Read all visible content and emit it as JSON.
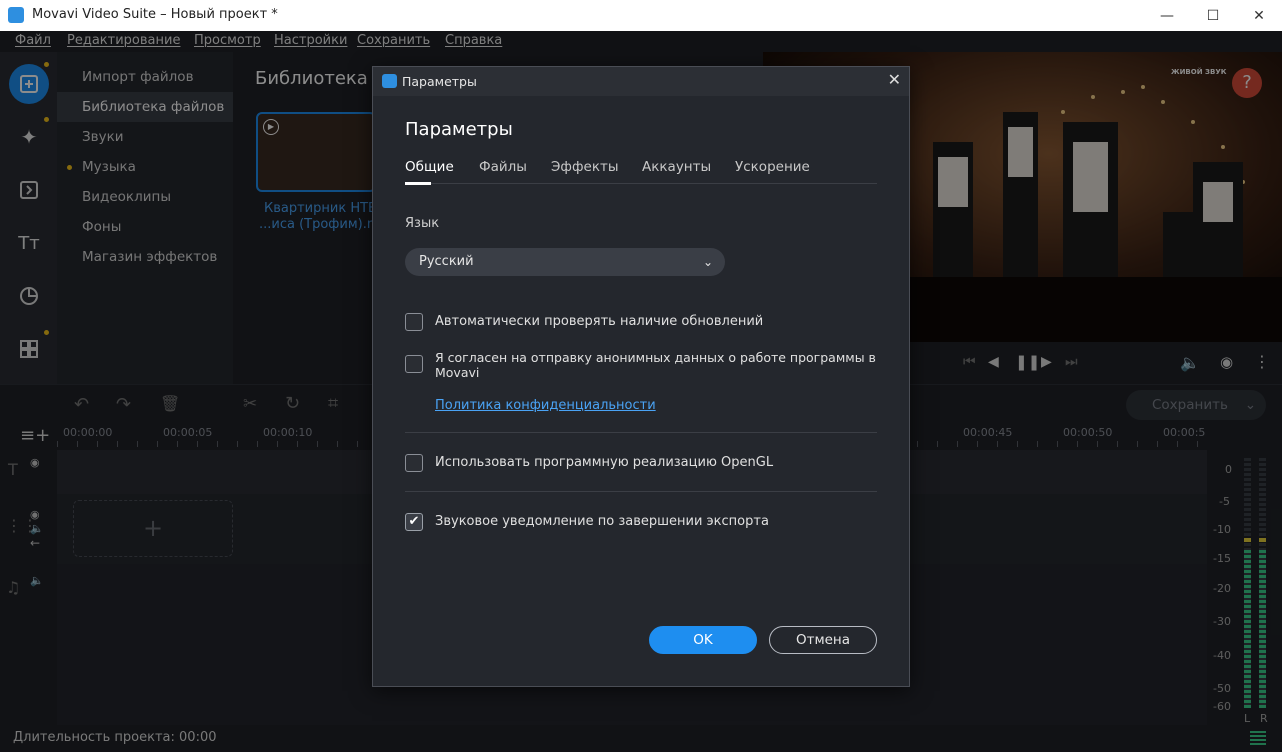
{
  "window": {
    "title": "Movavi Video Suite – Новый проект *"
  },
  "menu": [
    "Файл",
    "Редактирование",
    "Просмотр",
    "Настройки",
    "Сохранить",
    "Справка"
  ],
  "categories": [
    "Импорт файлов",
    "Библиотека файлов",
    "Звуки",
    "Музыка",
    "Видеоклипы",
    "Фоны",
    "Магазин эффектов"
  ],
  "library": {
    "title": "Библиотека",
    "clip_line1": "Квартирник НТВ",
    "clip_line2": "...иса (Трофим).m"
  },
  "preview": {
    "overlay_text": "ЖИВОЙ ЗВУК",
    "help_label": "?"
  },
  "toolbar": {
    "save_label": "Сохранить"
  },
  "ruler": [
    "00:00:00",
    "00:00:05",
    "00:00:10",
    "00:00:45",
    "00:00:50",
    "00:00:5"
  ],
  "meter": {
    "ticks": [
      "0",
      "-5",
      "-10",
      "-15",
      "-20",
      "-30",
      "-40",
      "-50",
      "-60"
    ],
    "left": "L",
    "right": "R"
  },
  "status": {
    "duration": "Длительность проекта: 00:00"
  },
  "dialog": {
    "window_title": "Параметры",
    "heading": "Параметры",
    "tabs": [
      "Общие",
      "Файлы",
      "Эффекты",
      "Аккаунты",
      "Ускорение"
    ],
    "language_label": "Язык",
    "language_value": "Русский",
    "check_updates": "Автоматически проверять наличие обновлений",
    "consent_line1": "Я согласен на отправку анонимных данных о работе программы в",
    "consent_line2": "Movavi",
    "privacy_link": "Политика конфиденциальности",
    "opengl": "Использовать программную реализацию OpenGL",
    "sound_notify": "Звуковое уведомление по завершении экспорта",
    "ok_label": "OK",
    "cancel_label": "Отмена"
  },
  "colors": {
    "accent": "#1e8ef0",
    "warning_dot": "#f4c21b",
    "meter_green": "#3bd08a",
    "meter_yellow": "#e8d23b"
  }
}
